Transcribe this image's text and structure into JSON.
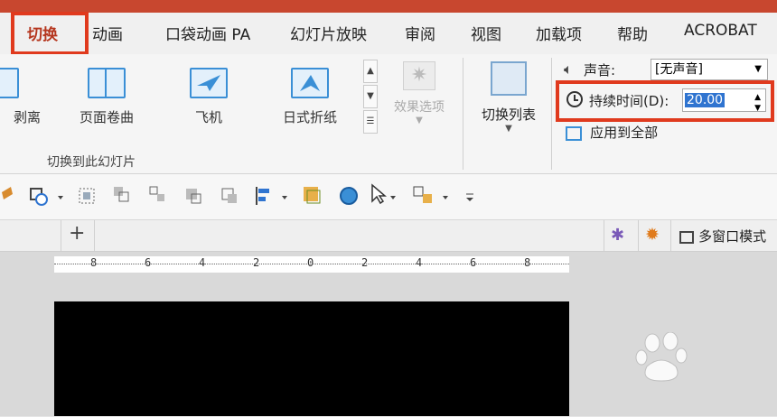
{
  "tabs": [
    "切换",
    "动画",
    "口袋动画 PA",
    "幻灯片放映",
    "审阅",
    "视图",
    "加载项",
    "帮助",
    "ACROBAT"
  ],
  "gallery": {
    "items": [
      "剥离",
      "页面卷曲",
      "飞机",
      "日式折纸"
    ],
    "group_label": "切换到此幻灯片"
  },
  "effect_options": "效果选项",
  "switch_list": "切换列表",
  "sound": {
    "label": "声音:",
    "value": "[无声音]"
  },
  "duration": {
    "label": "持续时间(D):",
    "value": "20.00"
  },
  "apply_all": "应用到全部",
  "panel": {
    "plus": "+",
    "multiwindow": "多窗口模式"
  },
  "ruler_labels": [
    "8",
    "6",
    "4",
    "2",
    "0",
    "2",
    "4",
    "6",
    "8"
  ],
  "colors": {
    "accent": "#c8472f",
    "highlight": "#e03a1e"
  }
}
